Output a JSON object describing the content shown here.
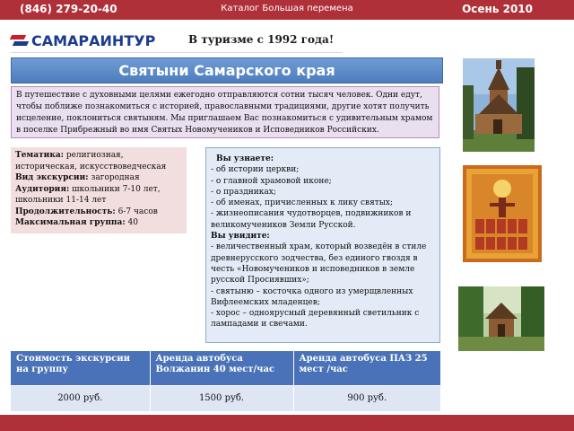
{
  "header": {
    "phone": "(846) 279-20-40",
    "center": "Каталог Большая перемена",
    "season": "Осень 2010"
  },
  "brand": {
    "name": "САМАРАИНТУР",
    "tagline": "В туризме с 1992 года!"
  },
  "title": "Святыни Самарского края",
  "intro": "В путешествие с духовными целями ежегодно отправляются сотни тысяч человек. Одни едут, чтобы поближе познакомиться с историей, православными традициями, другие хотят получить исцеление, поклониться святыням. Мы приглашаем Вас познакомиться с удивительным храмом в поселке Прибрежный во имя Святых Новомучеников и Исповедников Российских.",
  "facts": [
    {
      "label": "Тематика:",
      "value": " религиозная, историческая, искусствоведческая"
    },
    {
      "label": "Вид экскурсии:",
      "value": " загородная"
    },
    {
      "label": "Аудитория:",
      "value": " школьники 7-10 лет, школьники 11-14 лет"
    },
    {
      "label": "Продолжительность:",
      "value": " 6-7 часов"
    },
    {
      "label": "Максимальная группа:",
      "value": " 40"
    }
  ],
  "learn": {
    "heading1": "Вы узнаете:",
    "items1": [
      "- об истории церкви;",
      "-  о  главной храмовой иконе;",
      "-  о праздниках;",
      "- об  именах, причисленных к лику святых;",
      "-  жизнеописания чудотворцев, подвижников и великомучеников Земли Русской."
    ],
    "heading2": "Вы увидите:",
    "items2": [
      "- величественный храм, который возведён в стиле древнерусского зодчества, без единого гвоздя в честь «Новомучеников и исповедников в земле русской Просиявших»;",
      " - святыню – косточка одного из умерщвленных Вифлеемских младенцев;",
      " - хорос – одноярусный деревянный светильник с лампадами и свечами."
    ]
  },
  "price_table": {
    "headers": [
      "Стоимость экскурсии на группу",
      "Аренда автобуса Волжанин  40 мест/час",
      "Аренда автобуса  ПАЗ  25 мест /час"
    ],
    "row": [
      "2000 руб.",
      "1500 руб.",
      "900 руб."
    ]
  },
  "colors": {
    "bar_red": "#b0303a",
    "title_blue": "#4d7dbe",
    "table_header": "#4a72b8"
  }
}
